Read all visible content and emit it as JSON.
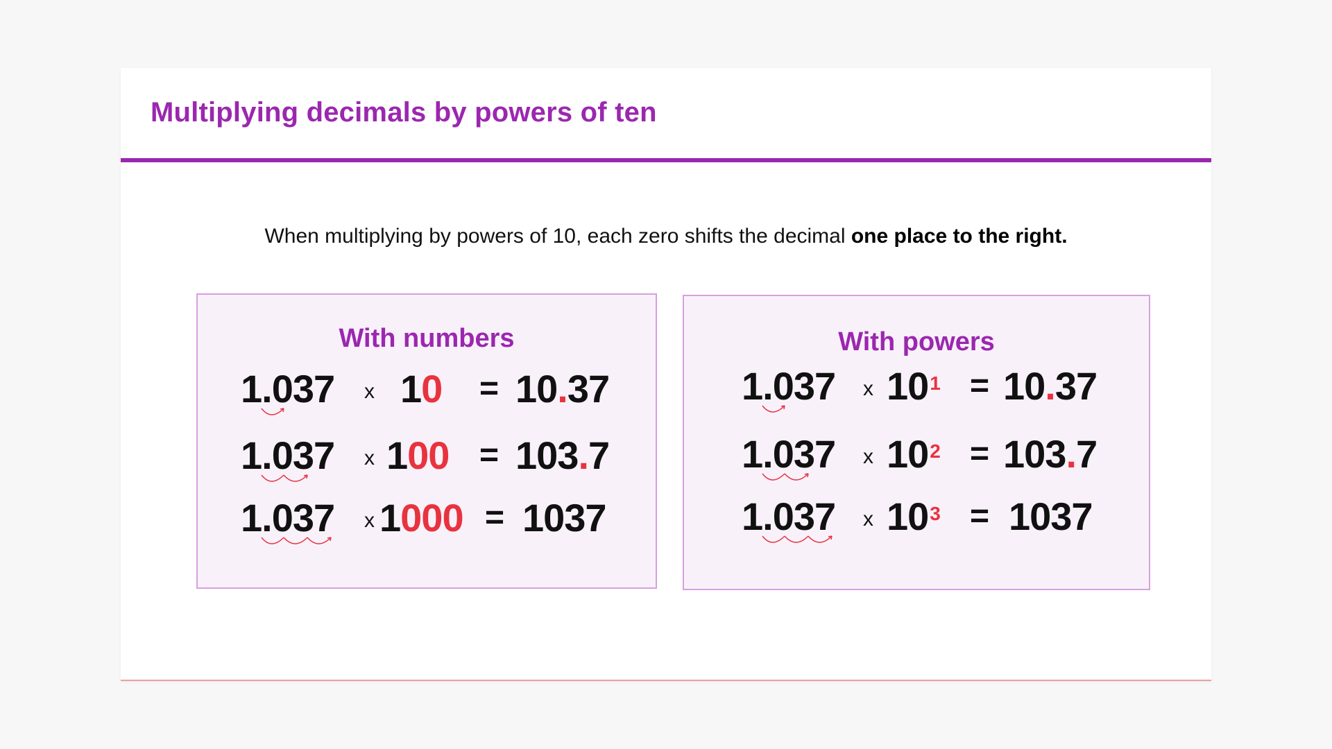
{
  "title": "Multiplying decimals by powers of ten",
  "intro": {
    "text": "When multiplying by powers of 10, each zero shifts the decimal ",
    "emphasis": "one place to the right."
  },
  "left_box": {
    "heading": "With numbers",
    "rows": [
      {
        "base": "1.037",
        "op": "x",
        "multiplier_lead": "1",
        "multiplier_red": "0",
        "equals": "=",
        "result_int": "10",
        "result_dot": ".",
        "result_frac": "37",
        "hops": 1
      },
      {
        "base": "1.037",
        "op": "x",
        "multiplier_lead": "1",
        "multiplier_red": "00",
        "equals": "=",
        "result_int": "103",
        "result_dot": ".",
        "result_frac": "7",
        "hops": 2
      },
      {
        "base": "1.037",
        "op": "x",
        "multiplier_lead": "1",
        "multiplier_red": "000",
        "equals": "=",
        "result_int": "1037",
        "result_dot": "",
        "result_frac": "",
        "hops": 3
      }
    ]
  },
  "right_box": {
    "heading": "With powers",
    "rows": [
      {
        "base": "1.037",
        "op": "x",
        "power_base": "10",
        "exponent": "1",
        "equals": "=",
        "result_int": "10",
        "result_dot": ".",
        "result_frac": "37",
        "hops": 1
      },
      {
        "base": "1.037",
        "op": "x",
        "power_base": "10",
        "exponent": "2",
        "equals": "=",
        "result_int": "103",
        "result_dot": ".",
        "result_frac": "7",
        "hops": 2
      },
      {
        "base": "1.037",
        "op": "x",
        "power_base": "10",
        "exponent": "3",
        "equals": "=",
        "result_int": "1037",
        "result_dot": "",
        "result_frac": "",
        "hops": 3
      }
    ]
  },
  "colors": {
    "accent_purple": "#9b27af",
    "highlight_red": "#e8333f",
    "box_fill": "#f8f1fa",
    "box_border": "#d7a0e0"
  }
}
